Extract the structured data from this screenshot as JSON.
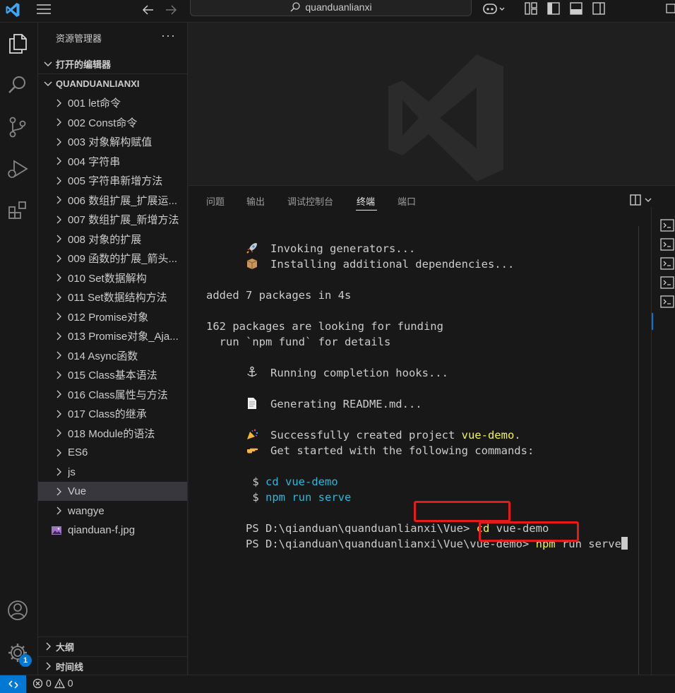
{
  "titlebar": {
    "search_text": "quanduanlianxi",
    "icons": [
      "vscode-logo-icon",
      "menu-icon",
      "back-arrow-icon",
      "forward-arrow-icon",
      "search-icon",
      "copilot-icon",
      "customize-layout-icon",
      "toggle-sidebar-icon",
      "toggle-panel-icon",
      "toggle-secondary-sidebar-icon",
      "maximize-icon"
    ]
  },
  "activitybar": {
    "items": [
      "explorer-icon",
      "search-icon",
      "source-control-icon",
      "run-debug-icon",
      "extensions-icon"
    ],
    "account_icon": "account-icon",
    "settings_icon": "settings-gear-icon",
    "settings_badge": "1"
  },
  "sidebar": {
    "title": "资源管理器",
    "more": "···",
    "open_editors": "打开的编辑器",
    "workspace": "QUANDUANLIANXI",
    "items": [
      {
        "label": "001 let命令",
        "type": "folder"
      },
      {
        "label": "002 Const命令",
        "type": "folder"
      },
      {
        "label": "003 对象解构赋值",
        "type": "folder"
      },
      {
        "label": "004 字符串",
        "type": "folder"
      },
      {
        "label": "005 字符串新增方法",
        "type": "folder"
      },
      {
        "label": "006 数组扩展_扩展运...",
        "type": "folder"
      },
      {
        "label": "007 数组扩展_新增方法",
        "type": "folder"
      },
      {
        "label": "008 对象的扩展",
        "type": "folder"
      },
      {
        "label": "009 函数的扩展_箭头...",
        "type": "folder"
      },
      {
        "label": "010 Set数据解构",
        "type": "folder"
      },
      {
        "label": "011 Set数据结构方法",
        "type": "folder"
      },
      {
        "label": "012 Promise对象",
        "type": "folder"
      },
      {
        "label": "013 Promise对象_Aja...",
        "type": "folder"
      },
      {
        "label": "014 Async函数",
        "type": "folder"
      },
      {
        "label": "015 Class基本语法",
        "type": "folder"
      },
      {
        "label": "016 Class属性与方法",
        "type": "folder"
      },
      {
        "label": "017 Class的继承",
        "type": "folder"
      },
      {
        "label": "018 Module的语法",
        "type": "folder"
      },
      {
        "label": "ES6",
        "type": "folder"
      },
      {
        "label": "js",
        "type": "folder"
      },
      {
        "label": "Vue",
        "type": "folder",
        "selected": true
      },
      {
        "label": "wangye",
        "type": "folder"
      },
      {
        "label": "qianduan-f.jpg",
        "type": "image"
      }
    ],
    "outline": "大纲",
    "timeline": "时间线"
  },
  "panel": {
    "tabs": [
      "问题",
      "输出",
      "调试控制台",
      "终端",
      "端口"
    ],
    "active_tab": "终端",
    "terminal_lines": {
      "l1": "Invoking generators...",
      "l2": "Installing additional dependencies...",
      "l3": "added 7 packages in 4s",
      "l4": "162 packages are looking for funding",
      "l5": "  run `npm fund` for details",
      "l6": "Running completion hooks...",
      "l7": "Generating README.md...",
      "l8a": "Successfully created project ",
      "l8b": "vue-demo",
      "l8c": ".",
      "l9": "Get started with the following commands:",
      "l10a": " $ ",
      "l10b": "cd vue-demo",
      "l11a": " $ ",
      "l11b": "npm run serve",
      "l12a": "PS D:\\qianduan\\quanduanlianxi\\Vue> ",
      "l12b": "cd",
      "l12c": " vue-demo",
      "l13a": "PS D:\\qianduan\\quanduanlianxi\\Vue\\vue-demo> ",
      "l13b": "npm",
      "l13c": " run serve"
    },
    "emoji_icons": [
      "rocket-icon",
      "package-icon",
      "anchor-icon",
      "page-icon",
      "party-popper-icon",
      "pointing-hand-icon"
    ],
    "terminal_instances": 5
  },
  "statusbar": {
    "errors": "0",
    "warnings": "0"
  },
  "colors": {
    "accent": "#0078d4",
    "highlight_box": "#e31b1b",
    "cyan": "#29b8db",
    "yellow": "#e5e510"
  }
}
